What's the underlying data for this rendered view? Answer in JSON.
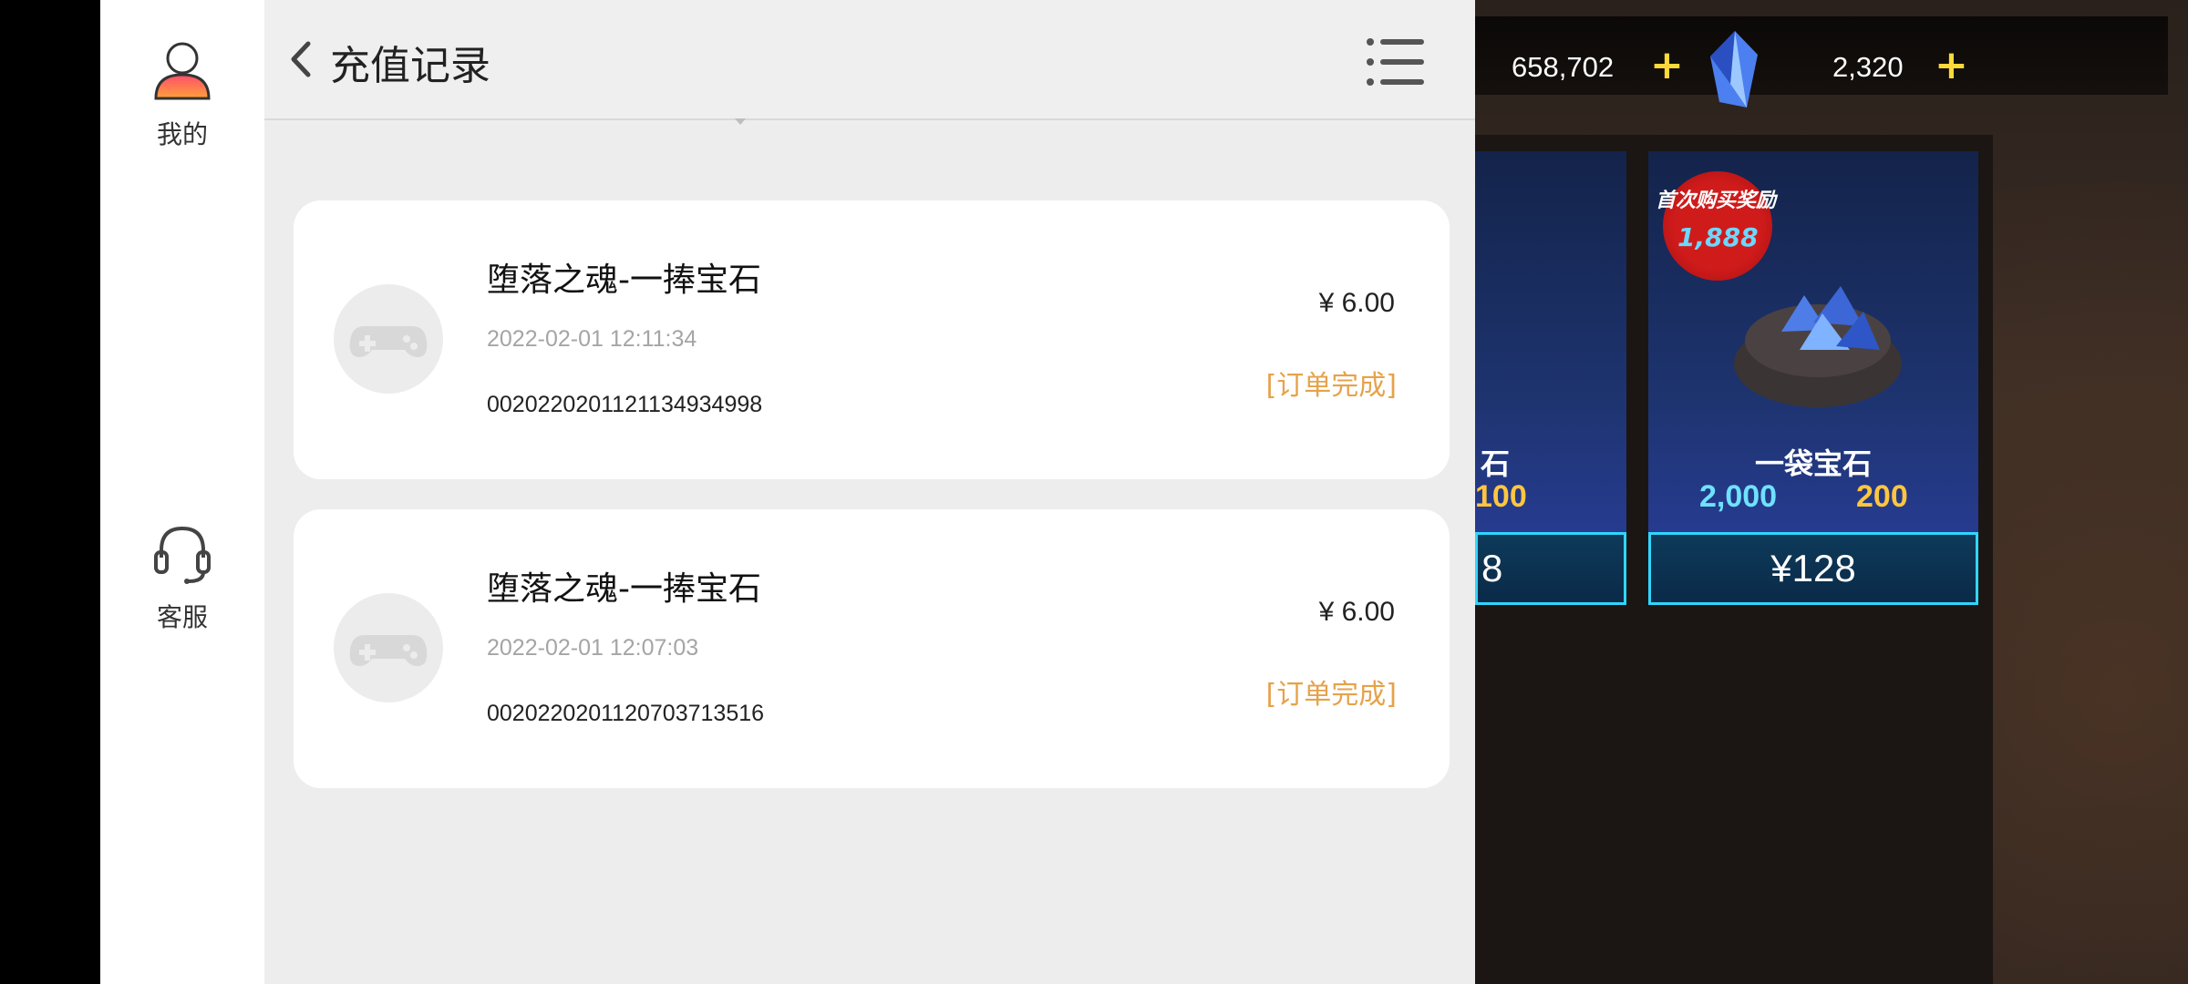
{
  "sidebar": {
    "items": [
      {
        "label": "我的",
        "icon": "user-icon"
      },
      {
        "label": "客服",
        "icon": "headset-icon"
      }
    ]
  },
  "header": {
    "title": "充值记录",
    "back_icon": "chevron-left-icon",
    "menu_icon": "menu-list-icon"
  },
  "records": [
    {
      "name": "堕落之魂-一捧宝石",
      "time": "2022-02-01 12:11:34",
      "order_no": "0020220201121134934998",
      "price": "¥ 6.00",
      "status": "[订单完成]"
    },
    {
      "name": "堕落之魂-一捧宝石",
      "time": "2022-02-01 12:07:03",
      "order_no": "0020220201120703713516",
      "price": "¥ 6.00",
      "status": "[订单完成]"
    }
  ],
  "game": {
    "gold": "658,702",
    "gems": "2,320",
    "cards": [
      {
        "partial_name": "石",
        "partial_stat": "100",
        "partial_price": "8"
      },
      {
        "badge_title": "首次购买奖励",
        "badge_value": "1,888",
        "name": "一袋宝石",
        "gems": "2,000",
        "gold": "200",
        "price": "¥128"
      }
    ]
  },
  "colors": {
    "status": "#e6a24a",
    "panel_bg": "#ededed",
    "card_button_border": "#2fd6ff"
  }
}
